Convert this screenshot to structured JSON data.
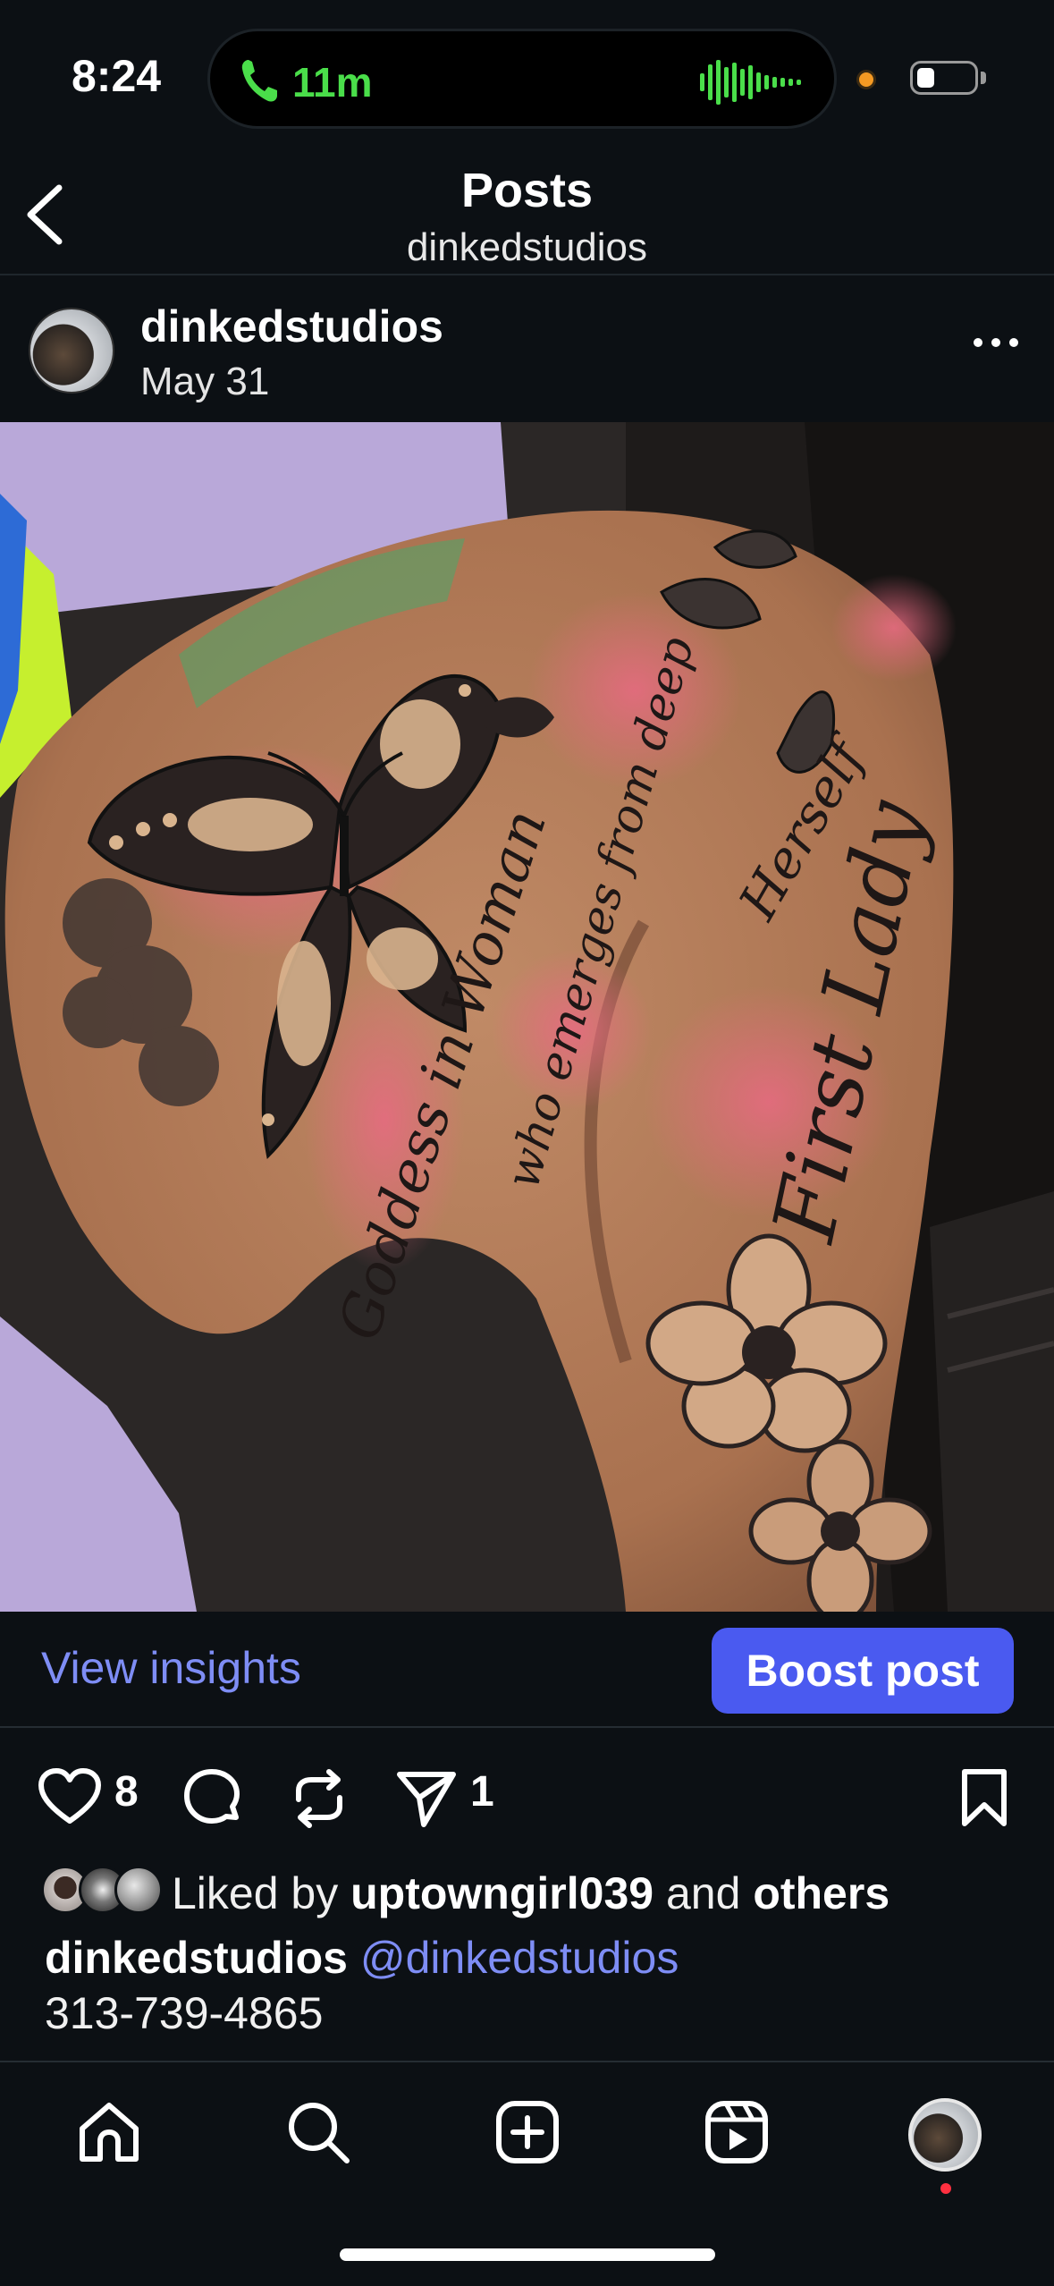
{
  "status_bar": {
    "time": "8:24",
    "call_duration": "11m",
    "call_icon": "phone-icon",
    "accent_green": "#4ade4a",
    "battery_level": 0.3
  },
  "header": {
    "title": "Posts",
    "subtitle": "dinkedstudios",
    "back_icon": "chevron-left-icon"
  },
  "post": {
    "author": "dinkedstudios",
    "date": "May 31",
    "more_icon": "ellipsis-icon",
    "image_description_icon": "tattoo-photo",
    "image_text": {
      "line1": "Goddess in Woman",
      "line2": "who emerges from deep",
      "line3": "First Lady",
      "line4": "Herself"
    }
  },
  "insights": {
    "view_insights_label": "View insights",
    "boost_label": "Boost post",
    "accent_blue": "#7e8df5",
    "boost_color": "#4a5af0"
  },
  "actions": {
    "like_count": "8",
    "share_count": "1",
    "icons": [
      "heart-icon",
      "comment-icon",
      "repost-icon",
      "send-icon",
      "bookmark-icon"
    ]
  },
  "likes": {
    "prefix": "Liked by",
    "user": "uptowngirl039",
    "connector": "and",
    "suffix": "others"
  },
  "caption": {
    "user": "dinkedstudios",
    "mention": "@dinkedstudios",
    "phone": "313-739-4865"
  },
  "nav": {
    "icons": [
      "home-icon",
      "search-icon",
      "create-icon",
      "reels-icon",
      "profile-avatar"
    ],
    "notification_color": "#ff3040"
  }
}
